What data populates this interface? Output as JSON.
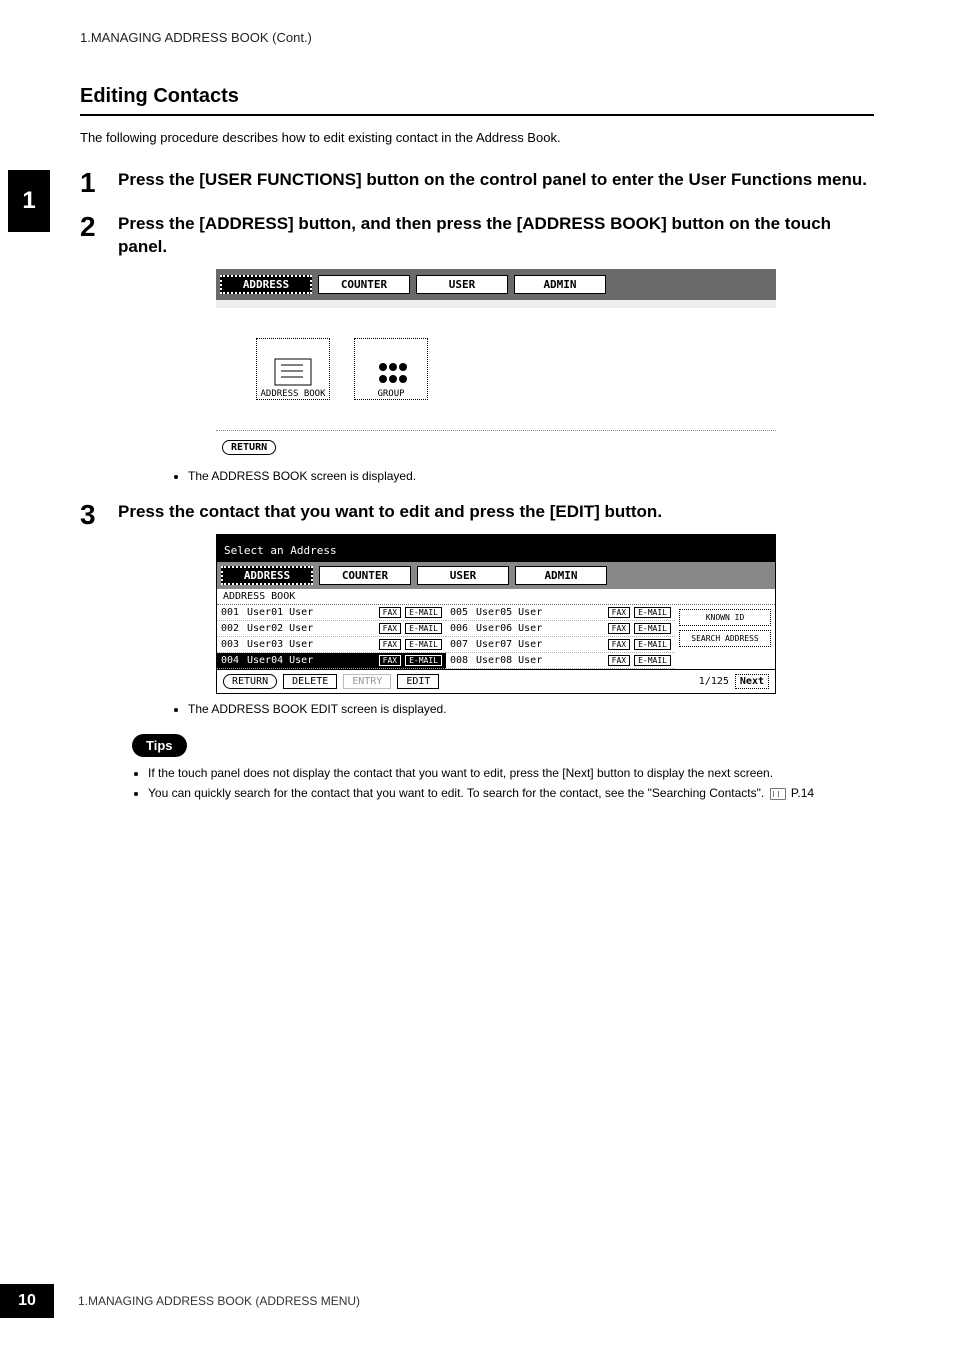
{
  "header": {
    "running": "1.MANAGING ADDRESS BOOK (Cont.)"
  },
  "chapter_tab": "1",
  "section": {
    "title": "Editing Contacts",
    "intro": "The following procedure describes how to edit existing contact in the Address Book."
  },
  "steps": [
    {
      "n": "1",
      "text": "Press the [USER FUNCTIONS] button on the control panel to enter the User Functions menu."
    },
    {
      "n": "2",
      "text": "Press the [ADDRESS] button, and then press the [ADDRESS BOOK] button on the touch panel.",
      "after_note": "The ADDRESS BOOK screen is displayed."
    },
    {
      "n": "3",
      "text": "Press the contact that you want to edit and press the [EDIT] button.",
      "after_note": "The ADDRESS BOOK EDIT screen is displayed."
    }
  ],
  "screenshot1": {
    "tabs": [
      "ADDRESS",
      "COUNTER",
      "USER",
      "ADMIN"
    ],
    "active_tab": 0,
    "icons": [
      {
        "label": "ADDRESS BOOK"
      },
      {
        "label": "GROUP"
      }
    ],
    "return_label": "RETURN"
  },
  "screenshot2": {
    "prompt": "Select an Address",
    "tabs": [
      "ADDRESS",
      "COUNTER",
      "USER",
      "ADMIN"
    ],
    "active_tab": 0,
    "subtitle": "ADDRESS BOOK",
    "rows_left": [
      {
        "num": "001",
        "name": "User01 User",
        "fax": "FAX",
        "email": "E-MAIL",
        "selected": false
      },
      {
        "num": "002",
        "name": "User02 User",
        "fax": "FAX",
        "email": "E-MAIL",
        "selected": false
      },
      {
        "num": "003",
        "name": "User03 User",
        "fax": "FAX",
        "email": "E-MAIL",
        "selected": false
      },
      {
        "num": "004",
        "name": "User04 User",
        "fax": "FAX",
        "email": "E-MAIL",
        "selected": true
      }
    ],
    "rows_right": [
      {
        "num": "005",
        "name": "User05 User",
        "fax": "FAX",
        "email": "E-MAIL"
      },
      {
        "num": "006",
        "name": "User06 User",
        "fax": "FAX",
        "email": "E-MAIL"
      },
      {
        "num": "007",
        "name": "User07 User",
        "fax": "FAX",
        "email": "E-MAIL"
      },
      {
        "num": "008",
        "name": "User08 User",
        "fax": "FAX",
        "email": "E-MAIL"
      }
    ],
    "side_buttons": [
      "KNOWN ID",
      "SEARCH ADDRESS"
    ],
    "footer": {
      "return": "RETURN",
      "delete": "DELETE",
      "entry": "ENTRY",
      "edit": "EDIT",
      "pager": "1/125",
      "next": "Next"
    }
  },
  "tips": {
    "label": "Tips",
    "items": [
      "If the touch panel does not display the contact that you want to edit, press the [Next] button to display the next screen.",
      "You can quickly search for the contact that you want to edit.  To search for the contact, see the \"Searching Contacts\"."
    ],
    "page_ref": "P.14"
  },
  "footer": {
    "page_number": "10",
    "text": "1.MANAGING ADDRESS BOOK (ADDRESS MENU)"
  }
}
